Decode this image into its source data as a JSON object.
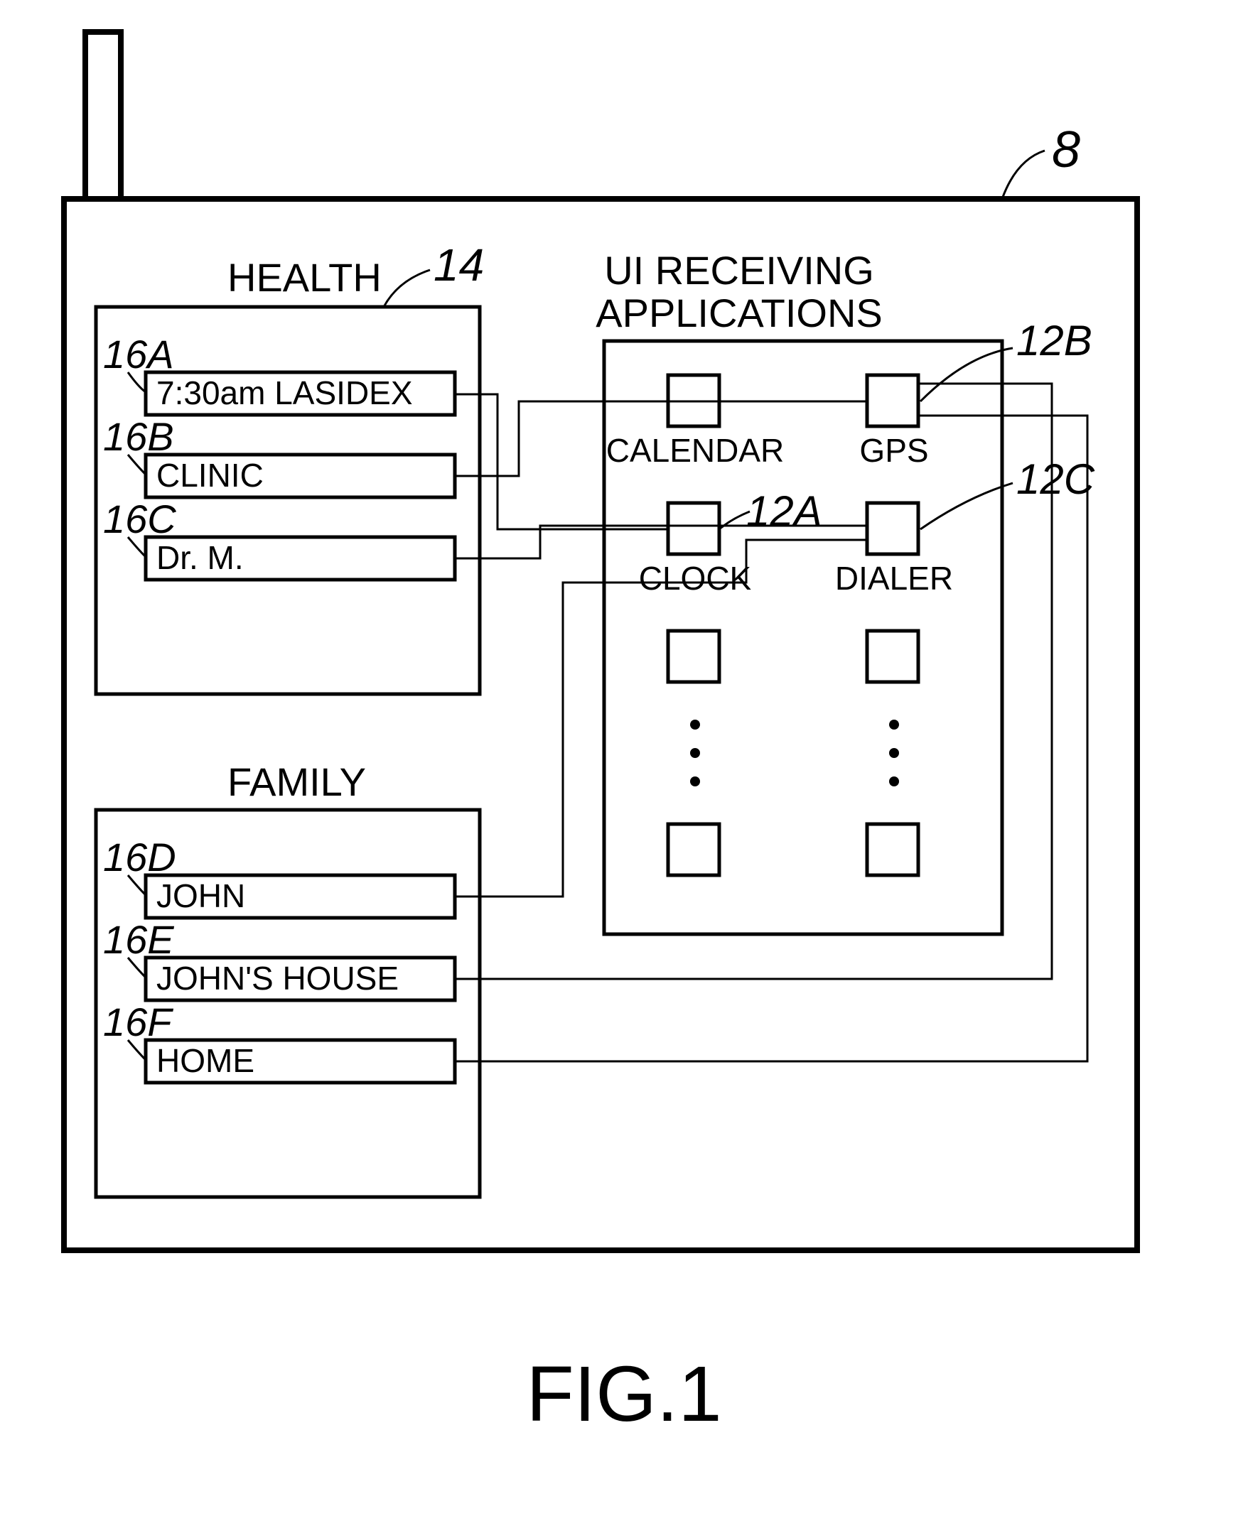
{
  "figure_caption": "FIG.1",
  "device_ref": "8",
  "left": {
    "health": {
      "title": "HEALTH",
      "ref": "14",
      "items": [
        {
          "ref": "16A",
          "text": "7:30am  LASIDEX"
        },
        {
          "ref": "16B",
          "text": "CLINIC"
        },
        {
          "ref": "16C",
          "text": "Dr.  M."
        }
      ]
    },
    "family": {
      "title": "FAMILY",
      "items": [
        {
          "ref": "16D",
          "text": "JOHN"
        },
        {
          "ref": "16E",
          "text": "JOHN'S  HOUSE"
        },
        {
          "ref": "16F",
          "text": "HOME"
        }
      ]
    }
  },
  "right": {
    "title_line1": "UI  RECEIVING",
    "title_line2": "APPLICATIONS",
    "ref_12A": "12A",
    "ref_12B": "12B",
    "ref_12C": "12C",
    "apps": {
      "calendar": "CALENDAR",
      "gps": "GPS",
      "clock": "CLOCK",
      "dialer": "DIALER"
    }
  }
}
